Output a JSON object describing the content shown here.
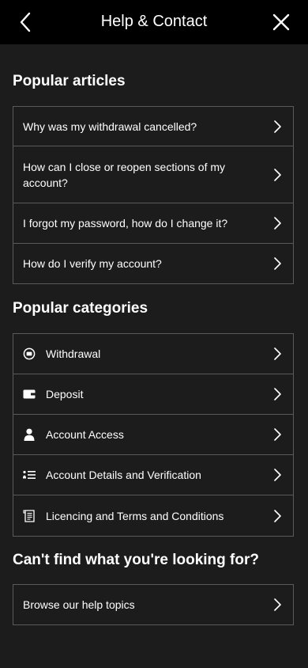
{
  "header": {
    "title": "Help & Contact",
    "back_icon": "chevron-left-icon",
    "close_icon": "close-icon"
  },
  "popular_articles": {
    "title": "Popular articles",
    "items": [
      {
        "label": "Why was my withdrawal cancelled?"
      },
      {
        "label": "How can I close or reopen sections of my account?"
      },
      {
        "label": "I forgot my password, how do I change it?"
      },
      {
        "label": "How do I verify my account?"
      }
    ]
  },
  "popular_categories": {
    "title": "Popular categories",
    "items": [
      {
        "label": "Withdrawal",
        "icon": "withdrawal-icon"
      },
      {
        "label": "Deposit",
        "icon": "wallet-icon"
      },
      {
        "label": "Account Access",
        "icon": "user-icon"
      },
      {
        "label": "Account Details and Verification",
        "icon": "list-icon"
      },
      {
        "label": "Licencing and Terms and Conditions",
        "icon": "document-icon"
      }
    ]
  },
  "cant_find": {
    "title": "Can't find what you're looking for?",
    "browse_label": "Browse our help topics"
  },
  "colors": {
    "background": "#1c1c1c",
    "header": "#000000",
    "border": "#5a5a5a",
    "text": "#ffffff"
  }
}
